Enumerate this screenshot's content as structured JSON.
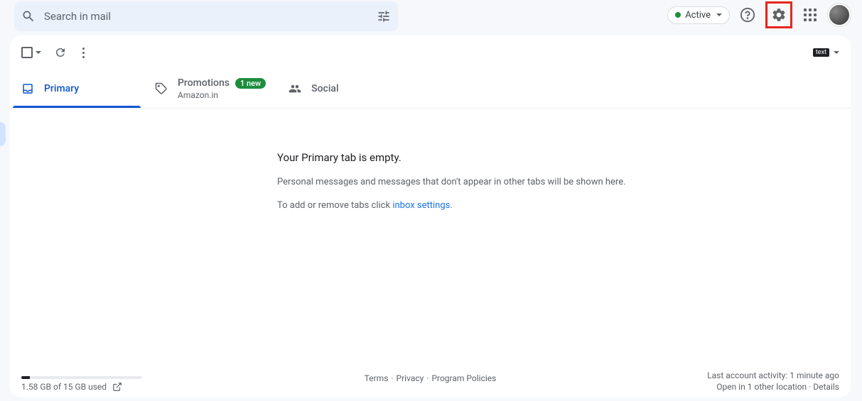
{
  "header": {
    "search_placeholder": "Search in mail",
    "status_label": "Active"
  },
  "toolbar": {
    "lang_badge": "text"
  },
  "tabs": [
    {
      "label": "Primary",
      "active": true
    },
    {
      "label": "Promotions",
      "badge": "1 new",
      "sublabel": "Amazon.in"
    },
    {
      "label": "Social"
    }
  ],
  "empty": {
    "title": "Your Primary tab is empty.",
    "line1": "Personal messages and messages that don't appear in other tabs will be shown here.",
    "line2_prefix": "To add or remove tabs click ",
    "line2_link": "inbox settings",
    "line2_suffix": "."
  },
  "footer": {
    "storage_text": "1.58 GB of 15 GB used",
    "links": {
      "terms": "Terms",
      "privacy": "Privacy",
      "policies": "Program Policies"
    },
    "activity": "Last account activity: 1 minute ago",
    "open_elsewhere": "Open in 1 other location",
    "details": "Details"
  }
}
